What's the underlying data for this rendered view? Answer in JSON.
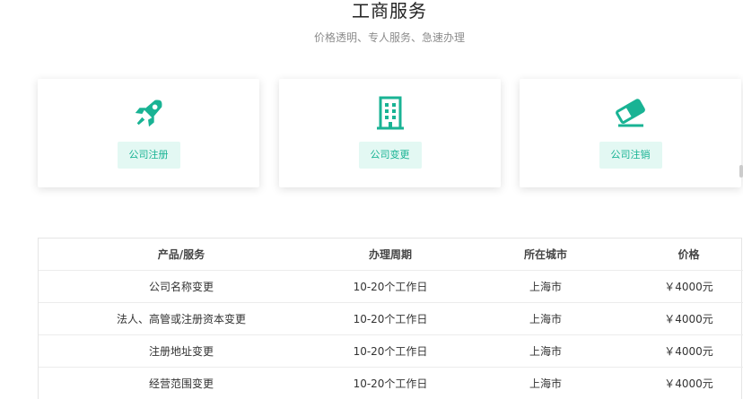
{
  "header": {
    "title": "工商服务",
    "subtitle": "价格透明、专人服务、急速办理"
  },
  "colors": {
    "accent": "#19b394",
    "button_bg": "#e3f8f3"
  },
  "cards": [
    {
      "icon": "rocket-icon",
      "label": "公司注册"
    },
    {
      "icon": "building-icon",
      "label": "公司变更"
    },
    {
      "icon": "eraser-icon",
      "label": "公司注销"
    }
  ],
  "table": {
    "headers": [
      "产品/服务",
      "办理周期",
      "所在城市",
      "价格"
    ],
    "rows": [
      [
        "公司名称变更",
        "10-20个工作日",
        "上海市",
        "￥4000元"
      ],
      [
        "法人、高管或注册资本变更",
        "10-20个工作日",
        "上海市",
        "￥4000元"
      ],
      [
        "注册地址变更",
        "10-20个工作日",
        "上海市",
        "￥4000元"
      ],
      [
        "经营范围变更",
        "10-20个工作日",
        "上海市",
        "￥4000元"
      ]
    ]
  }
}
